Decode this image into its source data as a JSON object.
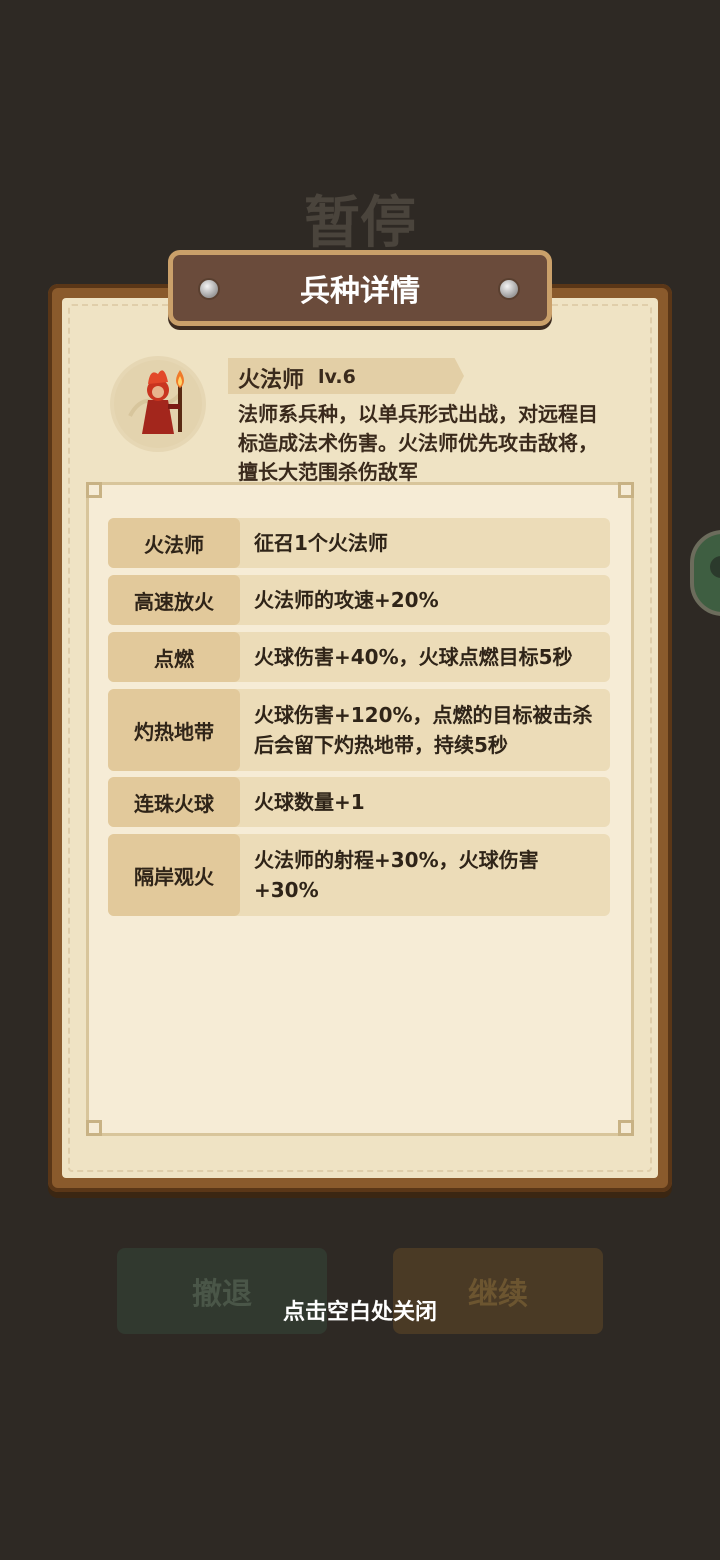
{
  "background": {
    "pause_title": "暂停",
    "retreat_label": "撤退",
    "continue_label": "继续"
  },
  "panel": {
    "title": "兵种详情",
    "unit": {
      "name": "火法师",
      "level": "lv.6",
      "description": "法师系兵种，以单兵形式出战，对远程目标造成法术伤害。火法师优先攻击敌将，擅长大范围杀伤敌军"
    },
    "skills": [
      {
        "name": "火法师",
        "desc": "征召1个火法师"
      },
      {
        "name": "高速放火",
        "desc": "火法师的攻速+20%"
      },
      {
        "name": "点燃",
        "desc": "火球伤害+40%，火球点燃目标5秒"
      },
      {
        "name": "灼热地带",
        "desc": "火球伤害+120%，点燃的目标被击杀后会留下灼热地带，持续5秒"
      },
      {
        "name": "连珠火球",
        "desc": "火球数量+1"
      },
      {
        "name": "隔岸观火",
        "desc": "火法师的射程+30%，火球伤害+30%"
      }
    ]
  },
  "hint": "点击空白处关闭",
  "colors": {
    "overlay_bg": "#2e2924",
    "frame": "#8a5a2c",
    "paper": "#efe3c4",
    "row_bg": "#ecdcb8",
    "row_label_bg": "#e2c99b"
  }
}
